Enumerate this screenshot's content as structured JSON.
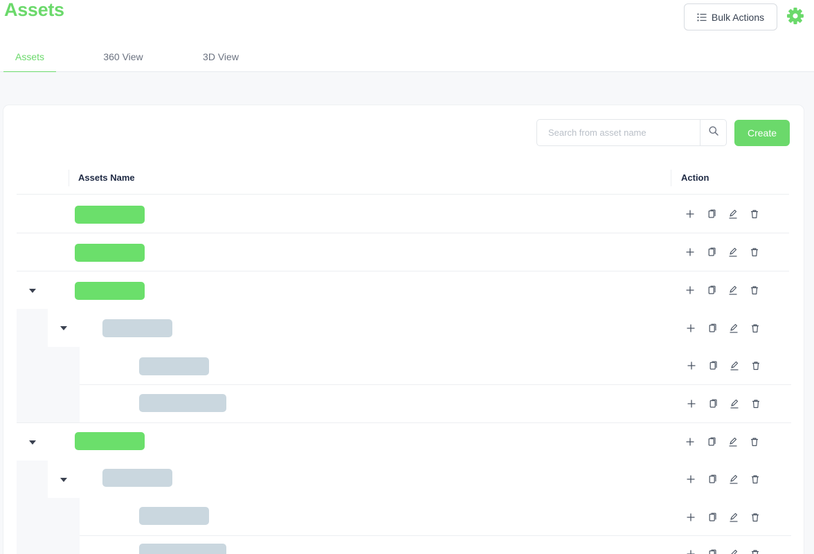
{
  "header": {
    "title": "Assets",
    "bulk_actions_label": "Bulk Actions"
  },
  "tabs": [
    {
      "label": "Assets",
      "active": true
    },
    {
      "label": "360 View",
      "active": false
    },
    {
      "label": "3D View",
      "active": false
    }
  ],
  "search": {
    "placeholder": "Search from asset name",
    "value": ""
  },
  "create_label": "Create",
  "table": {
    "columns": [
      "Assets Name",
      "Action"
    ]
  },
  "row_actions": [
    "plus-icon",
    "copy-icon",
    "edit-icon",
    "delete-icon"
  ],
  "colors": {
    "accent": "#6bd96b",
    "root_pill": "#6bdf6b",
    "child_pill": "#cad7df"
  }
}
